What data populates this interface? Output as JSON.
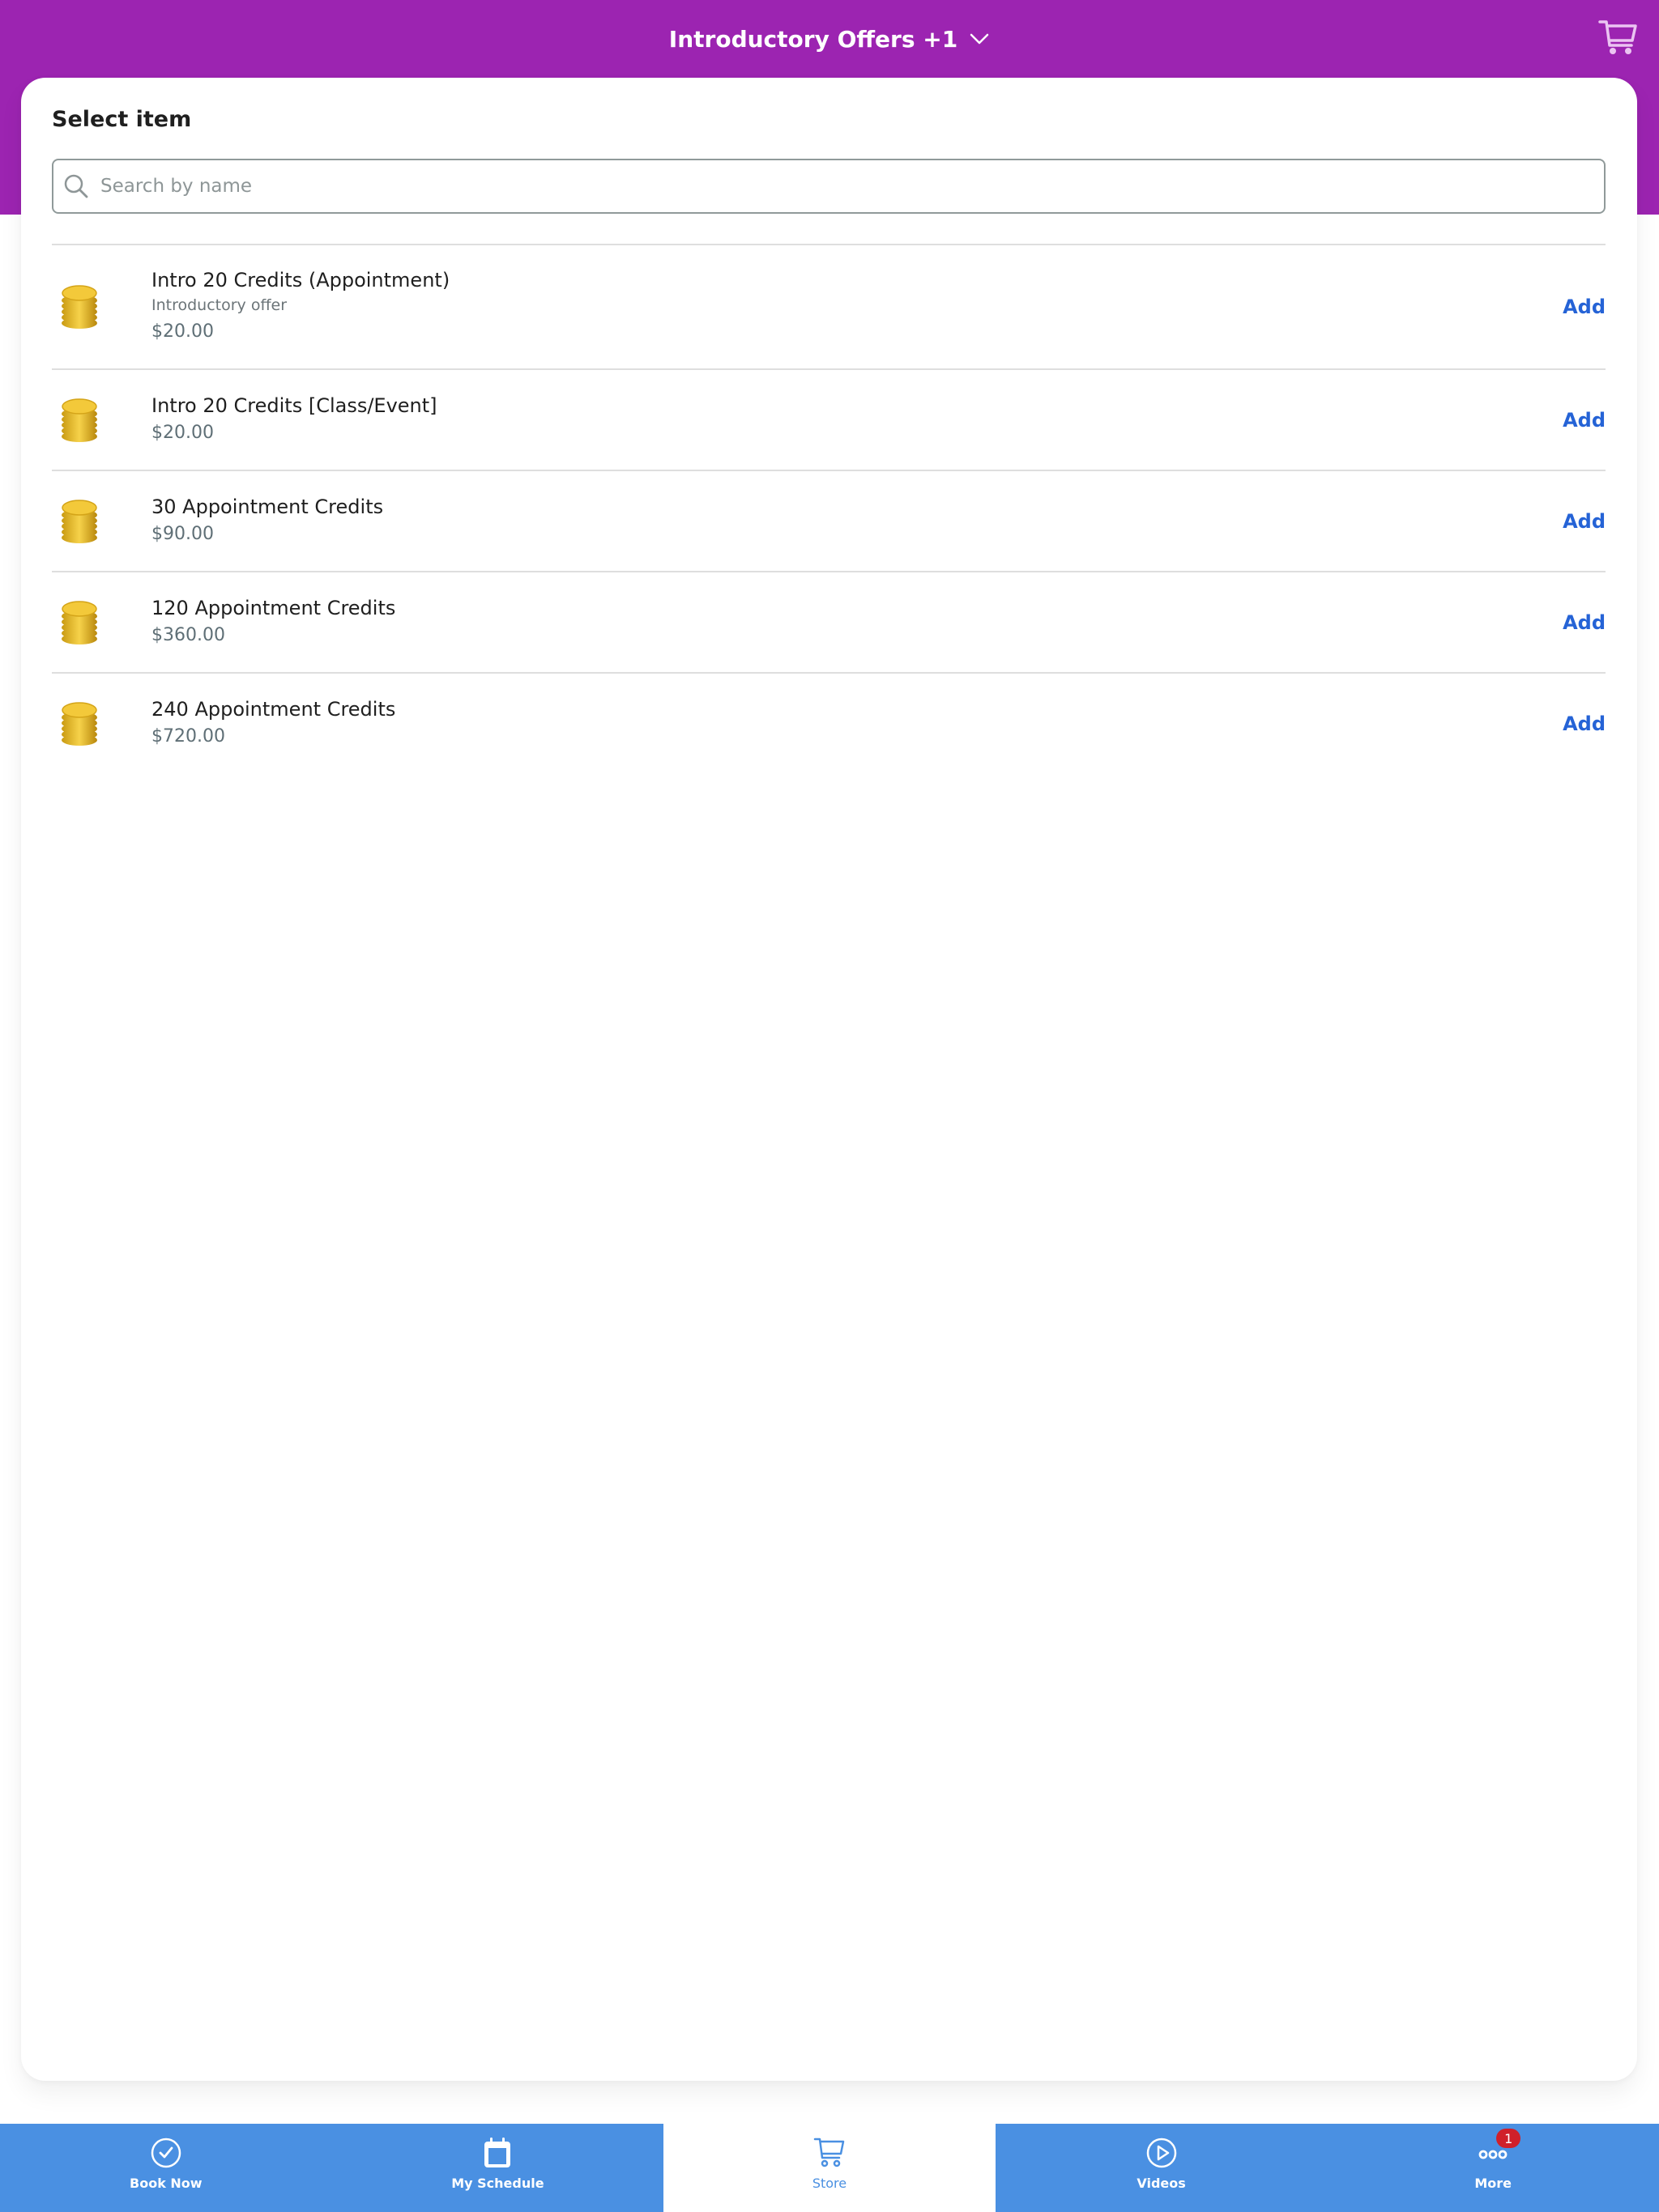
{
  "header": {
    "title": "Introductory Offers +1",
    "dropdown_icon": "chevron-down-icon",
    "cart_icon": "shopping-cart-icon",
    "background_color": "#9C24B1"
  },
  "card": {
    "title": "Select item",
    "search": {
      "placeholder": "Search by name",
      "value": "",
      "icon": "search-icon"
    }
  },
  "items": [
    {
      "name": "Intro 20 Credits (Appointment)",
      "subtitle": "Introductory offer",
      "price": "$20.00",
      "icon": "coin-stack-icon",
      "action": "Add"
    },
    {
      "name": "Intro 20 Credits [Class/Event]",
      "subtitle": null,
      "price": "$20.00",
      "icon": "coin-stack-icon",
      "action": "Add"
    },
    {
      "name": "30 Appointment Credits",
      "subtitle": null,
      "price": "$90.00",
      "icon": "coin-stack-icon",
      "action": "Add"
    },
    {
      "name": "120 Appointment Credits",
      "subtitle": null,
      "price": "$360.00",
      "icon": "coin-stack-icon",
      "action": "Add"
    },
    {
      "name": "240 Appointment Credits",
      "subtitle": null,
      "price": "$720.00",
      "icon": "coin-stack-icon",
      "action": "Add"
    }
  ],
  "tabbar": {
    "background_color": "#4A90E2",
    "active_index": 2,
    "tabs": [
      {
        "label": "Book Now",
        "icon": "check-circle-icon"
      },
      {
        "label": "My Schedule",
        "icon": "calendar-icon"
      },
      {
        "label": "Store",
        "icon": "shopping-cart-icon"
      },
      {
        "label": "Videos",
        "icon": "play-circle-icon"
      },
      {
        "label": "More",
        "icon": "more-dots-icon",
        "badge": "1"
      }
    ]
  }
}
